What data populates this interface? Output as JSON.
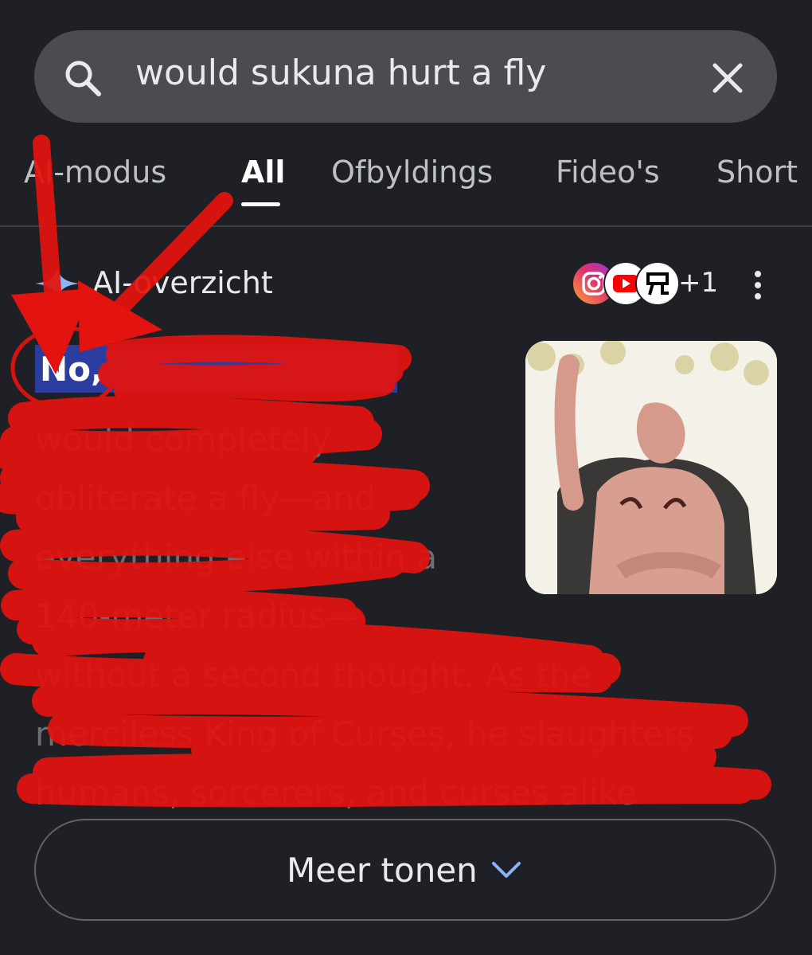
{
  "search": {
    "query": "would sukuna hurt a fly"
  },
  "tabs": [
    {
      "label": "AI-modus"
    },
    {
      "label": "All",
      "active": true
    },
    {
      "label": "Ofbyldings"
    },
    {
      "label": "Fideo's"
    },
    {
      "label": "Short"
    }
  ],
  "overview": {
    "title": "AI-overzicht",
    "source_count": "+1",
    "answer_lines": [
      "No, Ryomen Sukuna",
      "would completely",
      "obliterate a fly—and",
      "everything else within a",
      "140-meter radius—",
      "without a second thought. As the",
      "merciless King of Curses, he slaughters",
      "humans, sorcerers, and curses alike"
    ],
    "highlight_word": "No,"
  },
  "more_button": {
    "label": "Meer tonen"
  },
  "colors": {
    "background": "#1f2025",
    "highlight": "#2b3ea0",
    "annotation_red": "#e3130f"
  }
}
